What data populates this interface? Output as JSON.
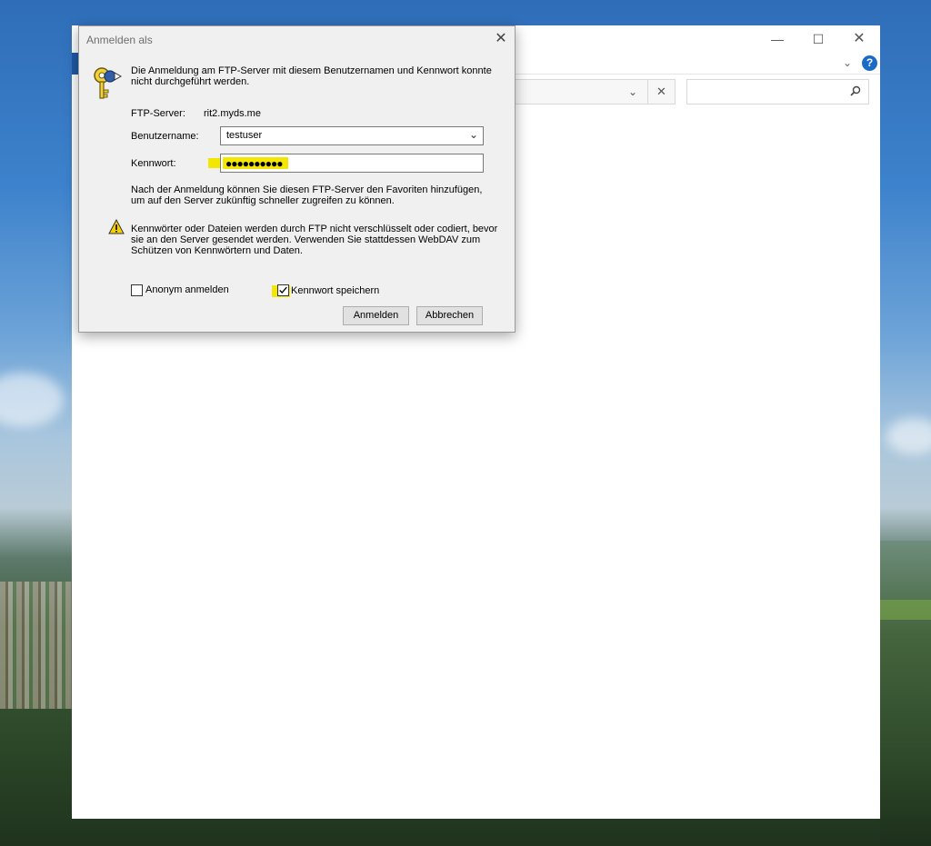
{
  "dialog": {
    "title": "Anmelden als",
    "message": "Die Anmeldung am FTP-Server mit diesem Benutzernamen und Kennwort konnte nicht durchgeführt werden.",
    "server_label": "FTP-Server:",
    "server_value": "rit2.myds.me",
    "username_label": "Benutzername:",
    "username_value": "testuser",
    "password_label": "Kennwort:",
    "password_mask": "●●●●●●●●●●",
    "info_text": "Nach der Anmeldung können Sie diesen FTP-Server den Favoriten hinzufügen, um auf den Server zukünftig schneller zugreifen zu können.",
    "warning_text": "Kennwörter oder Dateien werden durch FTP nicht verschlüsselt oder codiert, bevor sie an den Server gesendet werden. Verwenden Sie stattdessen WebDAV zum Schützen von Kennwörtern und Daten.",
    "anonymous_label": "Anonym anmelden",
    "anonymous_checked": false,
    "save_password_label": "Kennwort speichern",
    "save_password_checked": true,
    "login_button": "Anmelden",
    "cancel_button": "Abbrechen",
    "highlight_color": "#f3e600"
  },
  "explorer": {
    "help_symbol": "?",
    "accent_color": "#1f5aa6"
  },
  "icons": [
    "key-icon",
    "warning-icon",
    "close-icon",
    "minimize-icon",
    "maximize-icon",
    "chevron-down-icon",
    "search-icon",
    "help-icon",
    "checkmark-icon"
  ]
}
